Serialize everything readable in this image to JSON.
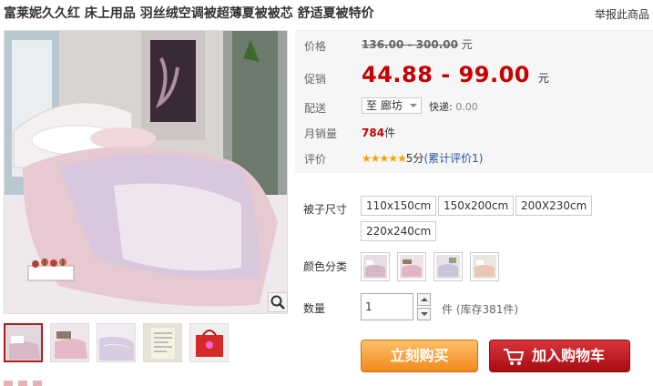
{
  "title": "富莱妮久久红 床上用品 羽丝绒空调被超薄夏被被芯 舒适夏被特价",
  "report_link": "举报此商品",
  "price": {
    "original_label": "价格",
    "original_value": "136.00 - 300.00",
    "currency": "元",
    "promo_label": "促销",
    "promo_value": "44.88 - 99.00",
    "promo_currency": "元"
  },
  "shipping": {
    "label": "配送",
    "to": "至",
    "city": "廊坊",
    "express_label": "快递:",
    "express_value": "0.00"
  },
  "sales": {
    "label": "月销量",
    "count": "784",
    "unit": "件"
  },
  "rating": {
    "label": "评价",
    "stars": "★★★★★",
    "score": "5分",
    "link_text": "(累计评价1)"
  },
  "options": {
    "size_label": "被子尺寸",
    "sizes": [
      "110x150cm",
      "150x200cm",
      "200X230cm",
      "220x240cm"
    ],
    "color_label": "颜色分类",
    "colors": [
      "color-1",
      "color-2",
      "color-3",
      "color-4"
    ]
  },
  "quantity": {
    "label": "数量",
    "value": "1",
    "unit": "件",
    "stock": "(库存381件)"
  },
  "buttons": {
    "buy": "立刻购买",
    "cart": "加入购物车"
  },
  "icons": [
    "search-zoom-icon",
    "cart-icon",
    "chevron-down-icon",
    "stepper-up-icon",
    "stepper-down-icon"
  ],
  "colors": {
    "price_red": "#c40000",
    "buy_orange": "#ef8a1c",
    "cart_red": "#a70d12",
    "star": "#f4a300",
    "link": "#2953a6"
  }
}
